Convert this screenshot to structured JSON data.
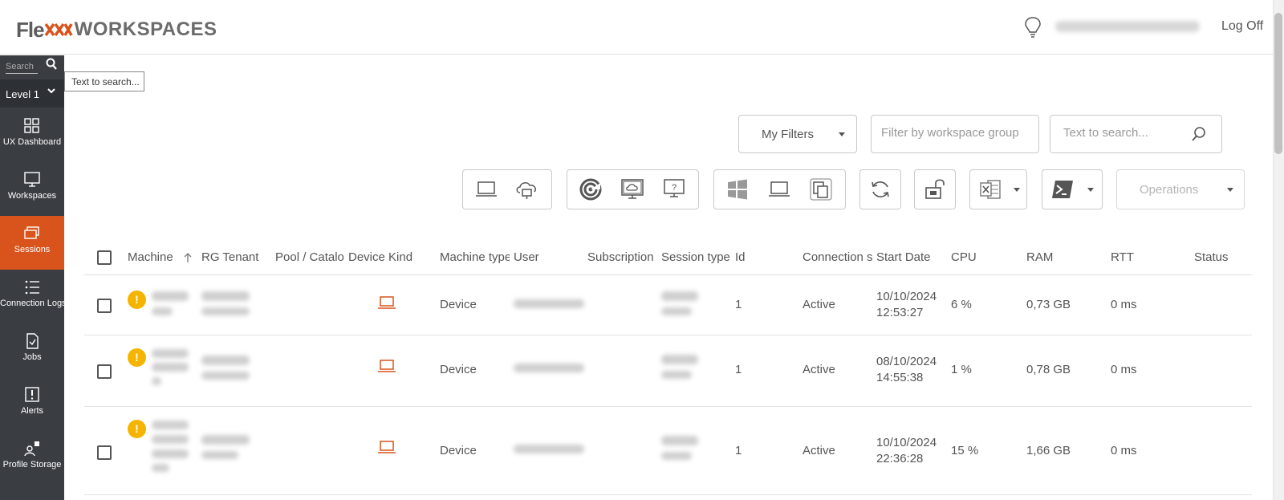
{
  "header": {
    "logo_prefix": "Fle",
    "logo_suffix": "WORKSPACES",
    "logoff_label": "Log Off",
    "icons": [
      "lightbulb-icon"
    ]
  },
  "sidebar": {
    "search_placeholder": "Search",
    "level_label": "Level 1",
    "items": [
      {
        "label": "UX Dashboard",
        "icon": "dashboard-icon"
      },
      {
        "label": "Workspaces",
        "icon": "monitor-icon"
      },
      {
        "label": "Sessions",
        "icon": "sessions-icon",
        "active": true
      },
      {
        "label": "Connection Logs",
        "icon": "list-icon"
      },
      {
        "label": "Jobs",
        "icon": "document-check-icon"
      },
      {
        "label": "Alerts",
        "icon": "alert-icon"
      },
      {
        "label": "Profile Storage",
        "icon": "profile-storage-icon"
      }
    ]
  },
  "tooltip": "Text to search...",
  "filters": {
    "my_filters_label": "My Filters",
    "workspace_group_placeholder": "Filter by workspace group",
    "text_search_placeholder": "Text to search..."
  },
  "toolbar": {
    "operations_label": "Operations",
    "icons": [
      "laptop-icon",
      "cloud-device-icon",
      "radar-icon",
      "cloud-monitor-icon",
      "unknown-monitor-icon",
      "windows-icon",
      "laptop-icon",
      "copy-icon",
      "refresh-icon",
      "unlock-icon",
      "excel-icon",
      "powershell-icon"
    ]
  },
  "table": {
    "columns": [
      "Machine",
      "RG Tenant",
      "Pool / Catalo",
      "Device Kind",
      "Machine type",
      "User",
      "Subscription",
      "Session type",
      "Id",
      "Connection s",
      "Start Date",
      "CPU",
      "RAM",
      "RTT",
      "Status"
    ],
    "rows": [
      {
        "machine_type": "Device",
        "id": "1",
        "connection": "Active",
        "start_date": "10/10/2024",
        "start_time": "12:53:27",
        "cpu": "6 %",
        "ram": "0,73 GB",
        "rtt": "0 ms"
      },
      {
        "machine_type": "Device",
        "id": "1",
        "connection": "Active",
        "start_date": "08/10/2024",
        "start_time": "14:55:38",
        "cpu": "1 %",
        "ram": "0,78 GB",
        "rtt": "0 ms"
      },
      {
        "machine_type": "Device",
        "id": "1",
        "connection": "Active",
        "start_date": "10/10/2024",
        "start_time": "22:36:28",
        "cpu": "15 %",
        "ram": "1,66 GB",
        "rtt": "0 ms"
      }
    ]
  },
  "colors": {
    "accent": "#d8541c",
    "sidebar_bg": "#3a3e43",
    "warning": "#f4b400"
  }
}
